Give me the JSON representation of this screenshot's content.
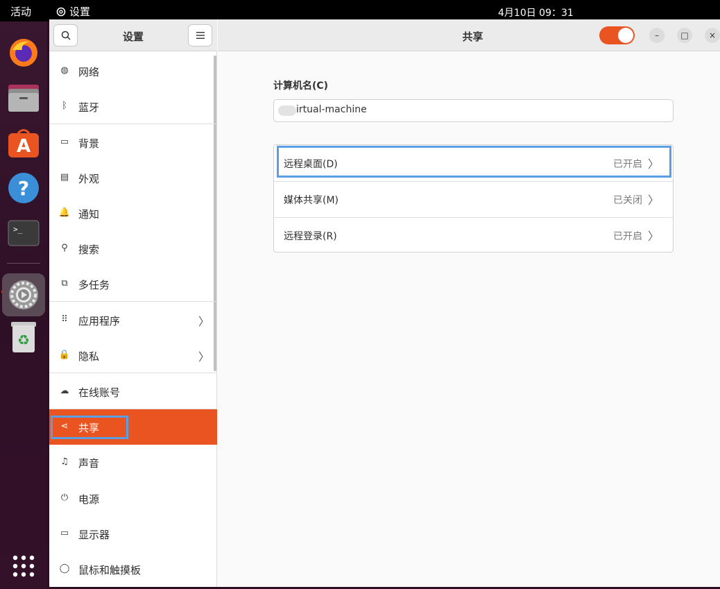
{
  "topbar": {
    "activities": "活动",
    "app_name": "设置",
    "clock": "4月10日  09：31"
  },
  "dock": {
    "items": [
      {
        "name": "firefox",
        "icon": "firefox-icon"
      },
      {
        "name": "files",
        "icon": "files-icon"
      },
      {
        "name": "app-center",
        "icon": "app-center-icon",
        "glyph": "A"
      },
      {
        "name": "help",
        "icon": "help-icon",
        "glyph": "?"
      },
      {
        "name": "terminal",
        "icon": "terminal-icon",
        "glyph": ">_"
      },
      {
        "name": "settings",
        "icon": "gear-icon"
      },
      {
        "name": "trash",
        "icon": "trash-icon",
        "glyph": "♻"
      }
    ]
  },
  "sidebar": {
    "title": "设置",
    "items": [
      {
        "label": "网络",
        "icon": "globe-icon",
        "glyph": "◍"
      },
      {
        "label": "蓝牙",
        "icon": "bluetooth-icon",
        "glyph": "ᛒ"
      },
      {
        "label": "背景",
        "icon": "background-icon",
        "glyph": "▭"
      },
      {
        "label": "外观",
        "icon": "appearance-icon",
        "glyph": "▤"
      },
      {
        "label": "通知",
        "icon": "bell-icon",
        "glyph": "🔔"
      },
      {
        "label": "搜索",
        "icon": "search-icon",
        "glyph": "⚲"
      },
      {
        "label": "多任务",
        "icon": "multitask-icon",
        "glyph": "⧉"
      },
      {
        "label": "应用程序",
        "icon": "apps-grid-icon",
        "glyph": "⠿",
        "chevron": "〉"
      },
      {
        "label": "隐私",
        "icon": "lock-icon",
        "glyph": "🔒",
        "chevron": "〉"
      },
      {
        "label": "在线账号",
        "icon": "cloud-icon",
        "glyph": "☁"
      },
      {
        "label": "共享",
        "icon": "share-icon",
        "glyph": "⋖",
        "active": true
      },
      {
        "label": "声音",
        "icon": "music-note-icon",
        "glyph": "♫"
      },
      {
        "label": "电源",
        "icon": "power-icon",
        "glyph": "⏻"
      },
      {
        "label": "显示器",
        "icon": "display-icon",
        "glyph": "▭"
      },
      {
        "label": "鼠标和触摸板",
        "icon": "mouse-icon",
        "glyph": "◯"
      }
    ]
  },
  "main": {
    "title": "共享",
    "sharing_enabled": true,
    "computer_name_label": "计算机名(C)",
    "computer_name_value": "irtual-machine",
    "rows": [
      {
        "name": "远程桌面(D)",
        "status": "已开启",
        "chevron": "〉"
      },
      {
        "name": "媒体共享(M)",
        "status": "已关闭",
        "chevron": "〉"
      },
      {
        "name": "远程登录(R)",
        "status": "已开启",
        "chevron": "〉"
      }
    ]
  },
  "window_controls": {
    "minimize": "–",
    "maximize": "□",
    "close": "×"
  },
  "colors": {
    "accent": "#e95420",
    "highlight": "#5a9fe6"
  }
}
